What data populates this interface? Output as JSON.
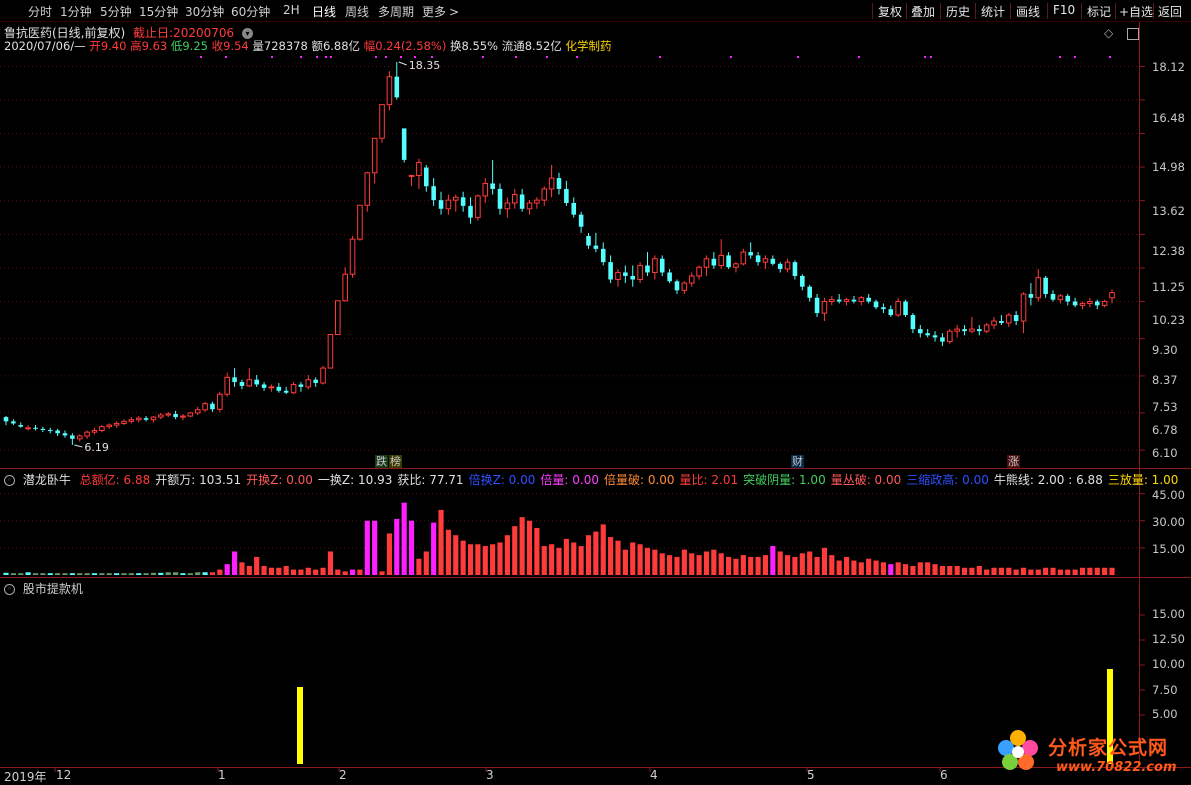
{
  "toolbar": {
    "periods": [
      {
        "label": "分时"
      },
      {
        "label": "1分钟"
      },
      {
        "label": "5分钟"
      },
      {
        "label": "15分钟"
      },
      {
        "label": "30分钟"
      },
      {
        "label": "60分钟"
      },
      {
        "label": "2H"
      },
      {
        "label": "日线"
      },
      {
        "label": "周线"
      },
      {
        "label": "多周期"
      },
      {
        "label": "更多"
      }
    ],
    "more_arrow": ">",
    "right_buttons": [
      {
        "label": "复权"
      },
      {
        "label": "叠加"
      },
      {
        "label": "历史"
      },
      {
        "label": "统计"
      },
      {
        "label": "画线"
      },
      {
        "label": "F10"
      },
      {
        "label": "标记"
      },
      {
        "label": "+自选"
      },
      {
        "label": "返回"
      }
    ]
  },
  "header": {
    "stock_name": "鲁抗医药(日线,前复权)",
    "end_date_label": "截止日:20200706",
    "date": "2020/07/06/—",
    "open": "开9.40",
    "high": "高9.63",
    "low": "低9.25",
    "close": "收9.54",
    "volume": "量728378",
    "amount": "额6.88亿",
    "change": "幅0.24(2.58%)",
    "turnover": "换8.55%",
    "float_cap": "流通8.52亿",
    "industry": "化学制药"
  },
  "price_axis": [
    "18.12",
    "16.48",
    "14.98",
    "13.62",
    "12.38",
    "11.25",
    "10.23",
    "9.30",
    "8.37",
    "7.53",
    "6.78",
    "6.10"
  ],
  "price_annotations": {
    "high": "18.35",
    "low": "6.19"
  },
  "event_tags": [
    {
      "text": "跌",
      "color": "#3fcf5f"
    },
    {
      "text": "榜",
      "color": "#ffd700"
    },
    {
      "text": "财",
      "color": "#4aa8ff"
    },
    {
      "text": "涨",
      "color": "#ff6060"
    }
  ],
  "indicator1": {
    "name": "潜龙卧牛",
    "items": [
      {
        "text": "总额亿: 6.88",
        "color": "#ff3b3b"
      },
      {
        "text": "开额万: 103.51",
        "color": "#e0e0e0"
      },
      {
        "text": "开换Z: 0.00",
        "color": "#ff5a5a"
      },
      {
        "text": "一换Z: 10.93",
        "color": "#e0e0e0"
      },
      {
        "text": "获比: 77.71",
        "color": "#e0e0e0"
      },
      {
        "text": "倍换Z: 0.00",
        "color": "#3050ff"
      },
      {
        "text": "倍量: 0.00",
        "color": "#ff40ff"
      },
      {
        "text": "倍量破: 0.00",
        "color": "#ff8a3a"
      },
      {
        "text": "量比: 2.01",
        "color": "#ff3b3b"
      },
      {
        "text": "突破阴量: 1.00",
        "color": "#3fcf5f"
      },
      {
        "text": "量丛破: 0.00",
        "color": "#ff5a5a"
      },
      {
        "text": "三缩政高: 0.00",
        "color": "#3050ff"
      },
      {
        "text": "牛熊线: 2.00 : 6.88",
        "color": "#e0e0e0"
      },
      {
        "text": "三放量: 1.00",
        "color": "#ffd700"
      }
    ],
    "axis": [
      "45.00",
      "30.00",
      "15.00"
    ]
  },
  "indicator2": {
    "name": "股市提款机",
    "axis": [
      "15.00",
      "12.50",
      "10.00",
      "7.50",
      "5.00"
    ],
    "bar_values": [
      7.8,
      9.6
    ]
  },
  "xaxis": [
    {
      "label": "2019年"
    },
    {
      "label": "12"
    },
    {
      "label": "1"
    },
    {
      "label": "2"
    },
    {
      "label": "3"
    },
    {
      "label": "4"
    },
    {
      "label": "5"
    },
    {
      "label": "6"
    }
  ],
  "watermark": {
    "text": "分析家公式网",
    "url": "www.70822.com"
  },
  "colors": {
    "up": "#ff3b3b",
    "down": "#54ffff",
    "magenta": "#ff20ff",
    "grid": "#8b1a1a",
    "yellow": "#ffff00"
  },
  "chart_data": [
    {
      "type": "candlestick",
      "title": "鲁抗医药(日线,前复权)",
      "ylim": [
        6.0,
        18.5
      ],
      "scale": "log",
      "ohlc": [
        [
          6.7,
          6.72,
          6.55,
          6.62
        ],
        [
          6.62,
          6.66,
          6.55,
          6.58
        ],
        [
          6.55,
          6.6,
          6.5,
          6.52
        ],
        [
          6.5,
          6.55,
          6.45,
          6.5
        ],
        [
          6.5,
          6.55,
          6.45,
          6.48
        ],
        [
          6.48,
          6.52,
          6.42,
          6.46
        ],
        [
          6.46,
          6.5,
          6.4,
          6.45
        ],
        [
          6.45,
          6.48,
          6.35,
          6.4
        ],
        [
          6.4,
          6.45,
          6.32,
          6.36
        ],
        [
          6.36,
          6.4,
          6.19,
          6.3
        ],
        [
          6.3,
          6.38,
          6.25,
          6.35
        ],
        [
          6.35,
          6.45,
          6.3,
          6.42
        ],
        [
          6.42,
          6.5,
          6.38,
          6.45
        ],
        [
          6.45,
          6.55,
          6.42,
          6.52
        ],
        [
          6.52,
          6.58,
          6.48,
          6.55
        ],
        [
          6.55,
          6.62,
          6.5,
          6.58
        ],
        [
          6.58,
          6.66,
          6.55,
          6.62
        ],
        [
          6.62,
          6.7,
          6.58,
          6.65
        ],
        [
          6.65,
          6.72,
          6.6,
          6.68
        ],
        [
          6.68,
          6.72,
          6.62,
          6.65
        ],
        [
          6.65,
          6.72,
          6.6,
          6.7
        ],
        [
          6.7,
          6.78,
          6.66,
          6.74
        ],
        [
          6.74,
          6.8,
          6.7,
          6.76
        ],
        [
          6.76,
          6.82,
          6.66,
          6.7
        ],
        [
          6.7,
          6.76,
          6.64,
          6.72
        ],
        [
          6.72,
          6.8,
          6.7,
          6.78
        ],
        [
          6.78,
          6.9,
          6.74,
          6.84
        ],
        [
          6.84,
          7.0,
          6.8,
          6.96
        ],
        [
          6.96,
          7.0,
          6.8,
          6.85
        ],
        [
          6.85,
          7.2,
          6.8,
          7.15
        ],
        [
          7.15,
          7.6,
          7.1,
          7.5
        ],
        [
          7.5,
          7.7,
          7.3,
          7.4
        ],
        [
          7.4,
          7.45,
          7.25,
          7.32
        ],
        [
          7.32,
          7.7,
          7.3,
          7.45
        ],
        [
          7.45,
          7.55,
          7.3,
          7.35
        ],
        [
          7.35,
          7.4,
          7.22,
          7.28
        ],
        [
          7.28,
          7.35,
          7.2,
          7.3
        ],
        [
          7.3,
          7.38,
          7.18,
          7.22
        ],
        [
          7.22,
          7.3,
          7.15,
          7.18
        ],
        [
          7.18,
          7.4,
          7.15,
          7.35
        ],
        [
          7.35,
          7.4,
          7.2,
          7.3
        ],
        [
          7.3,
          7.55,
          7.25,
          7.45
        ],
        [
          7.45,
          7.5,
          7.3,
          7.38
        ],
        [
          7.38,
          7.75,
          7.35,
          7.7
        ],
        [
          7.7,
          8.47,
          7.7,
          8.47
        ],
        [
          8.47,
          9.32,
          8.47,
          9.32
        ],
        [
          9.32,
          10.25,
          9.3,
          10.05
        ],
        [
          10.05,
          11.2,
          9.95,
          11.1
        ],
        [
          11.1,
          12.22,
          11.05,
          12.22
        ],
        [
          12.22,
          13.44,
          12.0,
          13.4
        ],
        [
          13.4,
          14.78,
          13.0,
          14.78
        ],
        [
          14.78,
          16.26,
          14.6,
          16.26
        ],
        [
          16.26,
          17.88,
          16.0,
          17.6
        ],
        [
          17.6,
          18.35,
          16.5,
          16.6
        ],
        [
          15.2,
          15.2,
          13.8,
          13.9
        ],
        [
          13.3,
          13.3,
          12.9,
          13.3
        ],
        [
          13.3,
          13.95,
          12.8,
          13.8
        ],
        [
          13.6,
          13.7,
          12.7,
          12.9
        ],
        [
          12.9,
          13.2,
          12.2,
          12.4
        ],
        [
          12.4,
          12.7,
          11.9,
          12.1
        ],
        [
          12.1,
          12.6,
          11.9,
          12.4
        ],
        [
          12.4,
          12.6,
          12.0,
          12.5
        ],
        [
          12.5,
          12.7,
          12.0,
          12.2
        ],
        [
          12.2,
          12.5,
          11.6,
          11.8
        ],
        [
          11.8,
          12.6,
          11.7,
          12.55
        ],
        [
          12.55,
          13.2,
          12.3,
          13.0
        ],
        [
          13.0,
          13.9,
          12.6,
          12.8
        ],
        [
          12.8,
          13.0,
          11.9,
          12.1
        ],
        [
          12.1,
          12.5,
          11.8,
          12.3
        ],
        [
          12.3,
          12.8,
          12.1,
          12.6
        ],
        [
          12.6,
          12.8,
          12.0,
          12.1
        ],
        [
          12.1,
          12.4,
          11.9,
          12.3
        ],
        [
          12.3,
          12.5,
          12.1,
          12.4
        ],
        [
          12.4,
          12.9,
          12.2,
          12.8
        ],
        [
          12.8,
          13.7,
          12.5,
          13.2
        ],
        [
          13.2,
          13.4,
          12.6,
          12.8
        ],
        [
          12.8,
          13.1,
          12.2,
          12.3
        ],
        [
          12.3,
          12.5,
          11.8,
          11.9
        ],
        [
          11.9,
          12.0,
          11.3,
          11.5
        ],
        [
          11.2,
          11.3,
          10.8,
          10.9
        ],
        [
          10.9,
          11.3,
          10.7,
          10.8
        ],
        [
          10.8,
          11.0,
          10.3,
          10.4
        ],
        [
          10.4,
          10.6,
          9.8,
          9.9
        ],
        [
          9.9,
          10.2,
          9.7,
          10.1
        ],
        [
          10.1,
          10.3,
          9.8,
          10.0
        ],
        [
          10.0,
          10.3,
          9.7,
          9.9
        ],
        [
          9.9,
          10.4,
          9.8,
          10.3
        ],
        [
          10.3,
          10.7,
          10.0,
          10.1
        ],
        [
          10.1,
          10.6,
          9.9,
          10.5
        ],
        [
          10.5,
          10.6,
          10.0,
          10.1
        ],
        [
          10.1,
          10.2,
          9.8,
          9.85
        ],
        [
          9.85,
          9.9,
          9.5,
          9.6
        ],
        [
          9.6,
          9.85,
          9.5,
          9.8
        ],
        [
          9.8,
          10.1,
          9.7,
          10.0
        ],
        [
          10.0,
          10.3,
          9.9,
          10.25
        ],
        [
          10.25,
          10.6,
          10.0,
          10.5
        ],
        [
          10.5,
          10.7,
          10.2,
          10.3
        ],
        [
          10.3,
          11.1,
          10.2,
          10.6
        ],
        [
          10.6,
          10.7,
          10.2,
          10.25
        ],
        [
          10.25,
          10.4,
          10.1,
          10.35
        ],
        [
          10.35,
          10.8,
          10.3,
          10.7
        ],
        [
          10.7,
          11.0,
          10.5,
          10.6
        ],
        [
          10.6,
          10.7,
          10.3,
          10.4
        ],
        [
          10.4,
          10.6,
          10.2,
          10.5
        ],
        [
          10.5,
          10.6,
          10.3,
          10.35
        ],
        [
          10.35,
          10.4,
          10.1,
          10.2
        ],
        [
          10.2,
          10.5,
          10.1,
          10.4
        ],
        [
          10.4,
          10.45,
          9.9,
          10.0
        ],
        [
          10.0,
          10.05,
          9.6,
          9.7
        ],
        [
          9.7,
          9.75,
          9.3,
          9.4
        ],
        [
          9.4,
          9.5,
          8.9,
          9.0
        ],
        [
          9.0,
          9.4,
          8.8,
          9.3
        ],
        [
          9.3,
          9.45,
          9.2,
          9.35
        ],
        [
          9.35,
          9.5,
          9.25,
          9.3
        ],
        [
          9.3,
          9.4,
          9.2,
          9.35
        ],
        [
          9.35,
          9.45,
          9.25,
          9.3
        ],
        [
          9.3,
          9.45,
          9.2,
          9.4
        ],
        [
          9.4,
          9.5,
          9.25,
          9.3
        ],
        [
          9.3,
          9.35,
          9.1,
          9.15
        ],
        [
          9.15,
          9.25,
          9.0,
          9.1
        ],
        [
          9.1,
          9.2,
          8.9,
          8.95
        ],
        [
          8.95,
          9.4,
          8.9,
          9.3
        ],
        [
          9.3,
          9.35,
          8.9,
          8.95
        ],
        [
          8.95,
          9.0,
          8.5,
          8.6
        ],
        [
          8.6,
          8.7,
          8.4,
          8.5
        ],
        [
          8.5,
          8.6,
          8.4,
          8.45
        ],
        [
          8.45,
          8.55,
          8.3,
          8.4
        ],
        [
          8.4,
          8.5,
          8.2,
          8.3
        ],
        [
          8.3,
          8.6,
          8.25,
          8.55
        ],
        [
          8.55,
          8.7,
          8.4,
          8.6
        ],
        [
          8.6,
          8.7,
          8.45,
          8.55
        ],
        [
          8.55,
          8.9,
          8.5,
          8.6
        ],
        [
          8.6,
          8.7,
          8.45,
          8.55
        ],
        [
          8.55,
          8.75,
          8.5,
          8.7
        ],
        [
          8.7,
          8.9,
          8.6,
          8.8
        ],
        [
          8.8,
          8.95,
          8.7,
          8.75
        ],
        [
          8.75,
          9.0,
          8.65,
          8.95
        ],
        [
          8.95,
          9.05,
          8.7,
          8.8
        ],
        [
          8.8,
          9.55,
          8.5,
          9.5
        ],
        [
          9.5,
          9.8,
          9.2,
          9.4
        ],
        [
          9.4,
          10.2,
          9.3,
          9.95
        ],
        [
          9.95,
          10.0,
          9.4,
          9.5
        ],
        [
          9.5,
          9.6,
          9.3,
          9.35
        ],
        [
          9.35,
          9.5,
          9.25,
          9.45
        ],
        [
          9.45,
          9.5,
          9.2,
          9.3
        ],
        [
          9.3,
          9.4,
          9.15,
          9.2
        ],
        [
          9.2,
          9.3,
          9.1,
          9.25
        ],
        [
          9.25,
          9.4,
          9.15,
          9.3
        ],
        [
          9.3,
          9.35,
          9.1,
          9.2
        ],
        [
          9.2,
          9.35,
          9.15,
          9.3
        ],
        [
          9.4,
          9.63,
          9.25,
          9.54
        ]
      ]
    },
    {
      "type": "bar",
      "title": "潜龙卧牛",
      "ylim": [
        0,
        50
      ],
      "values": [
        1.2,
        1,
        1,
        1.5,
        1,
        1,
        1,
        1,
        1,
        1,
        1,
        1,
        1,
        1,
        1,
        1,
        1,
        1,
        1,
        1,
        1.2,
        1.2,
        1.5,
        1.5,
        1,
        1,
        1.5,
        1.5,
        1.5,
        3,
        6,
        13,
        7,
        5,
        10,
        5,
        4,
        4,
        5,
        3,
        3,
        4,
        3,
        4,
        13,
        3,
        2,
        3,
        3,
        30,
        30,
        2,
        23,
        31,
        40,
        30,
        9,
        13,
        29,
        36,
        25,
        22,
        19,
        17,
        17,
        16,
        17,
        18,
        22,
        27,
        32,
        30,
        26,
        16,
        17,
        15,
        20,
        18,
        16,
        22,
        24,
        28,
        21,
        19,
        14,
        18,
        17,
        15,
        14,
        12,
        11,
        10,
        14,
        12,
        11,
        13,
        14,
        12,
        10,
        9,
        11,
        10,
        10,
        11,
        16,
        13,
        11,
        10,
        12,
        13,
        10,
        15,
        11,
        8,
        10,
        8,
        7,
        9,
        8,
        7,
        6,
        7,
        6,
        5,
        7,
        7,
        6,
        5,
        5,
        5,
        4,
        4,
        5,
        3,
        4,
        4,
        4,
        3,
        4,
        3,
        3,
        4,
        4,
        3,
        3,
        3,
        4,
        4,
        4,
        4,
        4,
        5,
        6,
        5,
        6,
        5,
        5,
        6,
        8,
        4,
        6,
        12,
        14,
        10,
        8,
        7,
        6,
        5,
        5,
        4,
        5,
        5,
        7,
        7
      ],
      "magenta_indices": [
        30,
        31,
        47,
        49,
        50,
        53,
        54,
        55,
        58,
        104,
        120,
        163,
        164,
        165
      ]
    },
    {
      "type": "bar",
      "title": "股市提款机",
      "ylim": [
        3.5,
        17.5
      ],
      "values": [
        7.8,
        9.6
      ]
    }
  ]
}
